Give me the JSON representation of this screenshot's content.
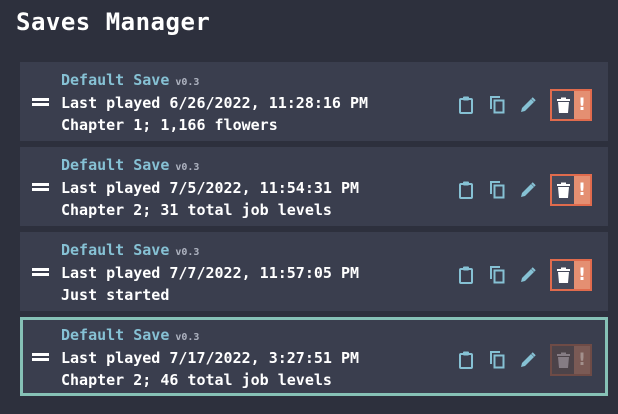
{
  "page": {
    "title": "Saves Manager"
  },
  "saves": [
    {
      "name": "Default Save",
      "version": "v0.3",
      "last_played": "Last played 6/26/2022, 11:28:16 PM",
      "progress": "Chapter 1; 1,166 flowers",
      "selected": false
    },
    {
      "name": "Default Save",
      "version": "v0.3",
      "last_played": "Last played 7/5/2022, 11:54:31 PM",
      "progress": "Chapter 2; 31 total job levels",
      "selected": false
    },
    {
      "name": "Default Save",
      "version": "v0.3",
      "last_played": "Last played 7/7/2022, 11:57:05 PM",
      "progress": "Just started",
      "selected": false
    },
    {
      "name": "Default Save",
      "version": "v0.3",
      "last_played": "Last played 7/17/2022, 3:27:51 PM",
      "progress": "Chapter 2; 46 total job levels",
      "selected": true
    }
  ],
  "actions": {
    "export_icon": "clipboard-icon",
    "duplicate_icon": "copy-icon",
    "rename_icon": "pencil-icon",
    "delete_icon": "trash-icon",
    "confirm_glyph": "!"
  },
  "colors": {
    "background": "#2d303d",
    "card": "#3a3e4e",
    "accent": "#86c1d4",
    "selected_border": "#86c1b6",
    "danger": "#e06b4d"
  }
}
